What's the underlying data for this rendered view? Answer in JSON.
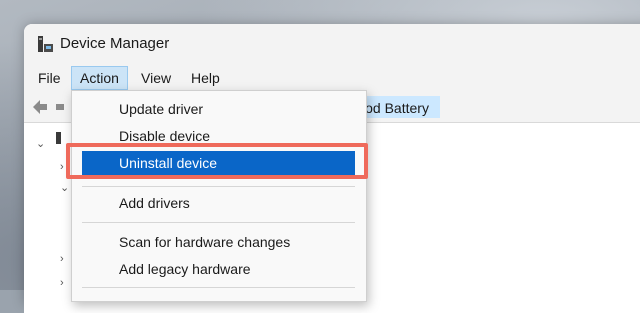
{
  "window": {
    "title": "Device Manager"
  },
  "menubar": {
    "items": [
      "File",
      "Action",
      "View",
      "Help"
    ],
    "active": "Action"
  },
  "toolbar": {
    "icons": [
      "back-arrow-icon",
      "remove-device-icon",
      "update-driver-icon"
    ]
  },
  "tree": {
    "selected_label": "Method Battery"
  },
  "action_menu": {
    "items": [
      {
        "label": "Update driver"
      },
      {
        "label": "Disable device"
      },
      {
        "label": "Uninstall device",
        "highlighted": true
      },
      {
        "label": "Add drivers"
      },
      {
        "label": "Scan for hardware changes"
      },
      {
        "label": "Add legacy hardware"
      }
    ]
  },
  "colors": {
    "highlight": "#0a66c8",
    "annotation": "#ef6a5b",
    "active_menu": "#cce4f7",
    "selection": "#cce8ff"
  }
}
